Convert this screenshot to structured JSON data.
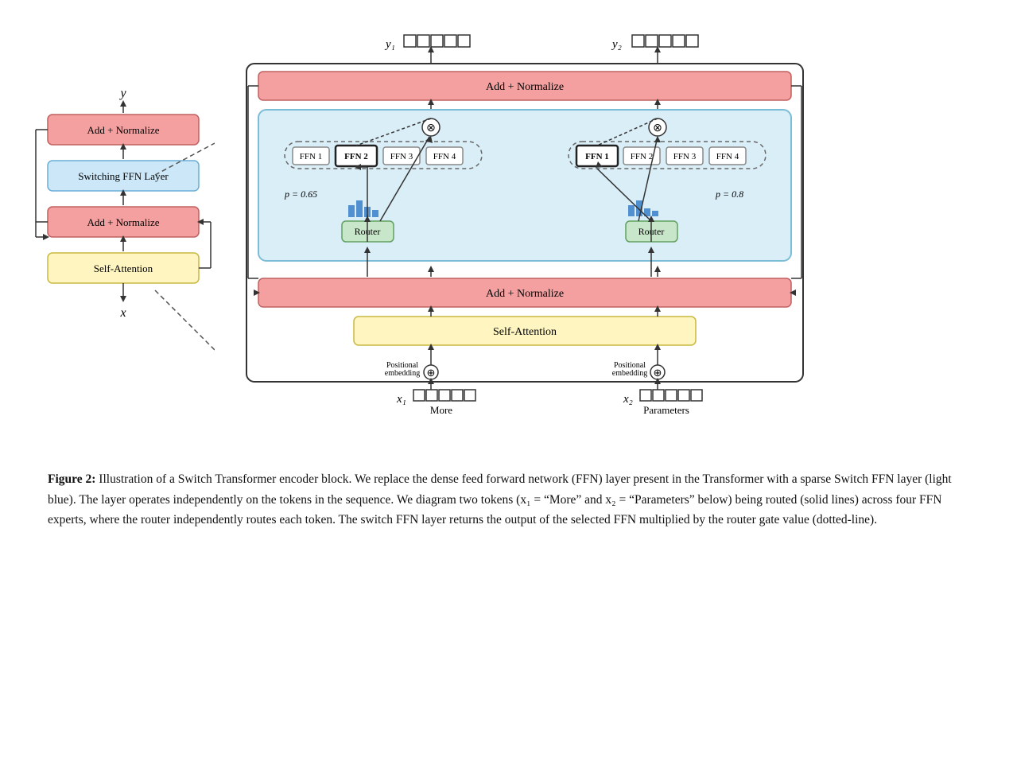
{
  "diagram": {
    "left": {
      "y_label": "y",
      "x_label": "x",
      "add_norm_top": "Add + Normalize",
      "switching_ffn": "Switching FFN Layer",
      "add_norm_bottom": "Add + Normalize",
      "self_attention": "Self-Attention"
    },
    "right": {
      "output_labels": [
        "y₁",
        "y₂"
      ],
      "add_norm_top": "Add + Normalize",
      "add_norm_middle": "Add + Normalize",
      "self_attention": "Self-Attention",
      "ffn_labels": [
        "FFN 1",
        "FFN 2",
        "FFN 3",
        "FFN 4"
      ],
      "ffn_selected_left": 1,
      "ffn_selected_right": 0,
      "prob_left": "p = 0.65",
      "prob_right": "p = 0.8",
      "router_label": "Router",
      "input_labels": [
        "x₁",
        "x₂"
      ],
      "input_sublabels": [
        "More",
        "Parameters"
      ],
      "pos_emb": "Positional\nembedding"
    }
  },
  "caption": {
    "fig_label": "Figure 2:",
    "text": " Illustration of a Switch Transformer encoder block.  We replace the dense feed forward network (FFN) layer present in the Transformer with a sparse Switch FFN layer (light blue).  The layer operates independently on the tokens in the sequence.  We diagram two tokens (x₁ = “More” and x₂ = “Parameters” below) being routed (solid lines) across four FFN experts, where the router independently routes each token.  The switch FFN layer returns the output of the selected FFN multiplied by the router gate value (dotted-line)."
  }
}
